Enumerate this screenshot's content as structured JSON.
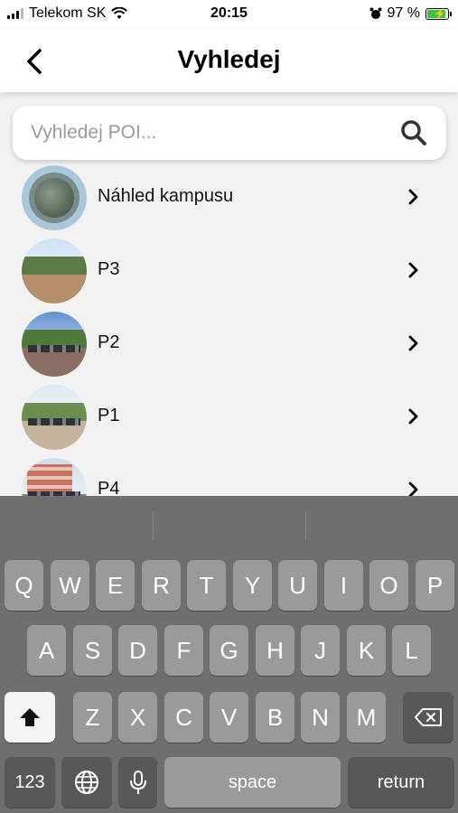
{
  "status_bar": {
    "carrier": "Telekom SK",
    "time": "20:15",
    "battery": "97 %",
    "battery_level": 0.97,
    "icons": [
      "signal-icon",
      "wifi-icon",
      "alarm-icon",
      "battery-charging-icon"
    ]
  },
  "header": {
    "title": "Vyhledej",
    "back_icon": "chevron-left-icon"
  },
  "search": {
    "placeholder": "Vyhledej POI...",
    "value": "",
    "icon": "search-icon"
  },
  "list": {
    "items": [
      {
        "label": "Náhled kampusu",
        "thumbnail": "campus-panorama"
      },
      {
        "label": "P3",
        "thumbnail": "parking-photo"
      },
      {
        "label": "P2",
        "thumbnail": "parking-photo"
      },
      {
        "label": "P1",
        "thumbnail": "parking-photo"
      },
      {
        "label": "P4",
        "thumbnail": "building-parking-photo"
      }
    ]
  },
  "keyboard": {
    "row1": [
      "Q",
      "W",
      "E",
      "R",
      "T",
      "Y",
      "U",
      "I",
      "O",
      "P"
    ],
    "row2": [
      "A",
      "S",
      "D",
      "F",
      "G",
      "H",
      "J",
      "K",
      "L"
    ],
    "row3": [
      "Z",
      "X",
      "C",
      "V",
      "B",
      "N",
      "M"
    ],
    "numbers_key": "123",
    "space_key": "space",
    "return_key": "return",
    "icons": [
      "shift-icon",
      "backspace-icon",
      "globe-icon",
      "microphone-icon"
    ]
  },
  "colors": {
    "accent": "#3b6fe0",
    "background": "#f2f2f2",
    "keyboard": "#6f6f6f",
    "key": "#9a9a9a",
    "battery": "#3ac43a"
  }
}
